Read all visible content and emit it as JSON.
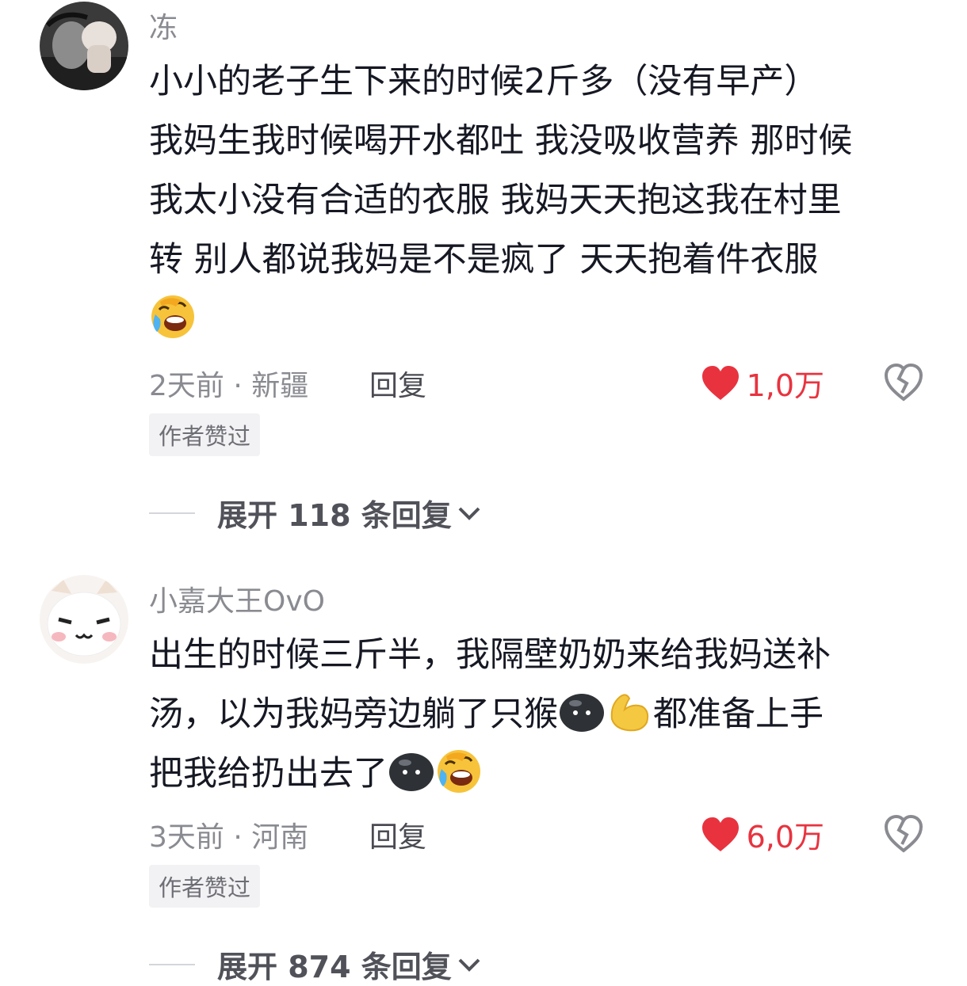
{
  "comments": [
    {
      "username": "冻",
      "lines": [
        "小小的老子生下来的时候2斤多（没有早产）",
        "我妈生我时候喝开水都吐 我没吸收营养  那时候",
        "我太小没有合适的衣服 我妈天天抱这我在村里",
        "转 别人都说我妈是不是疯了 天天抱着件衣服"
      ],
      "trailing_emoji": "laugh-cry-emoji",
      "time": "2天前",
      "location": "新疆",
      "meta": "2天前 · 新疆",
      "reply_label": "回复",
      "like_count": "1,0万",
      "author_badge": "作者赞过",
      "expand_label": "展开 118 条回复"
    },
    {
      "username": "小嘉大王OvO",
      "line1": "出生的时候三斤半，我隔壁奶奶来给我妈送补",
      "line2_a": "汤，以为我妈旁边躺了只猴",
      "line2_b": "都准备上手",
      "line3": "把我给扔出去了",
      "meta": "3天前 · 河南",
      "reply_label": "回复",
      "like_count": "6,0万",
      "author_badge": "作者赞过",
      "expand_label": "展开 874 条回复"
    }
  ],
  "colors": {
    "like_red": "#e8333f",
    "meta_gray": "#8a8b91",
    "text_dark": "#161823"
  },
  "icons": [
    "laugh-cry-emoji",
    "black-blob-emoji",
    "flexed-arm-emoji",
    "heart-filled-icon",
    "broken-heart-icon",
    "chevron-down-icon"
  ]
}
